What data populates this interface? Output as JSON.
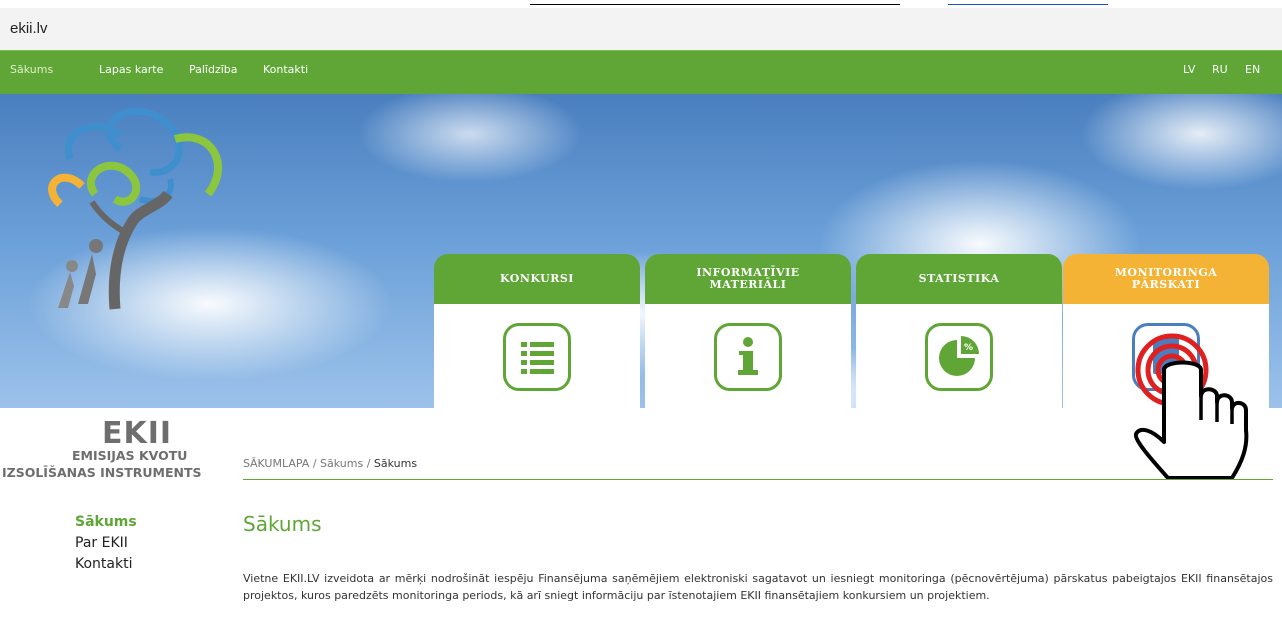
{
  "browser": {
    "url": "ekii.lv"
  },
  "nav": {
    "items": [
      "Sākums",
      "Lapas karte",
      "Palīdzība",
      "Kontakti"
    ],
    "languages": [
      "LV",
      "RU",
      "EN"
    ]
  },
  "logo": {
    "title": "EKII",
    "subtitle_line1": "EMISIJAS KVOTU",
    "subtitle_line2": "IZSOLĪŠANAS INSTRUMENTS"
  },
  "tiles": [
    {
      "label": "KONKURSI",
      "color": "#5fa636",
      "icon": "list-icon"
    },
    {
      "label": "INFORMATĪVIE\nMATERIĀLI",
      "color": "#5fa636",
      "icon": "info-icon"
    },
    {
      "label": "STATISTIKA",
      "color": "#5fa636",
      "icon": "pie-chart-icon"
    },
    {
      "label": "MONITORINGA\nPĀRSKATI",
      "color": "#f5b335",
      "icon": "report-icon"
    }
  ],
  "breadcrumb": {
    "root": "SĀKUMLAPA",
    "sep": " / ",
    "mid": "Sākums",
    "current": "Sākums"
  },
  "sidebar": {
    "items": [
      "Sākums",
      "Par EKII",
      "Kontakti"
    ]
  },
  "main": {
    "title": "Sākums",
    "intro": "Vietne EKII.LV izveidota ar mērķi nodrošināt iespēju Finansējuma saņēmējiem elektroniski sagatavot un iesniegt monitoringa (pēcnovērtējuma) pārskatus pabeigtajos EKII finansētajos projektos, kuros paredzēts monitoringa periods, kā arī sniegt informāciju par īstenotajiem EKII finansētajiem konkursiem un projektiem."
  },
  "colors": {
    "brand_green": "#5fa636",
    "accent_orange": "#f5b335"
  }
}
